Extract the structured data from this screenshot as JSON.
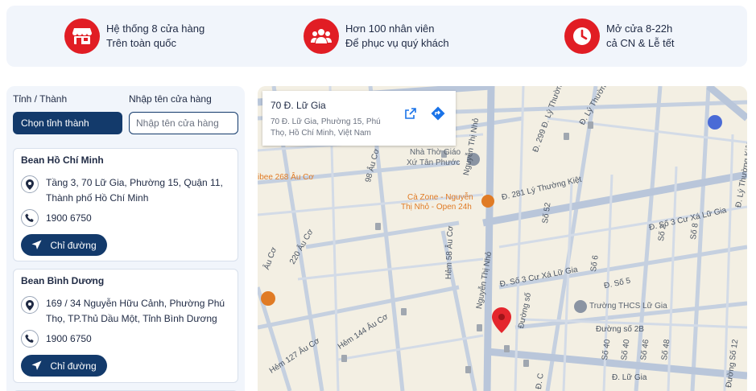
{
  "features": [
    {
      "icon": "store-icon",
      "line1": "Hệ thống 8 cửa hàng",
      "line2": "Trên toàn quốc"
    },
    {
      "icon": "people-icon",
      "line1": "Hơn 100 nhân viên",
      "line2": "Để phục vụ quý khách"
    },
    {
      "icon": "clock-icon",
      "line1": "Mở cửa 8-22h",
      "line2": "cả CN & Lễ tết"
    }
  ],
  "filters": {
    "province_label": "Tỉnh / Thành",
    "province_button": "Chọn tỉnh thành",
    "store_label": "Nhập tên cửa hàng",
    "store_placeholder": "Nhập tên cửa hàng"
  },
  "stores": [
    {
      "name": "Bean Hồ Chí Minh",
      "address": "Tầng 3, 70 Lữ Gia, Phường 15, Quận 11, Thành phố Hồ Chí Minh",
      "phone": "1900 6750",
      "directions": "Chỉ đường"
    },
    {
      "name": "Bean Bình Dương",
      "address": "169 / 34 Nguyễn Hữu Cảnh, Phường Phú Thọ, TP.Thủ Dầu Một, Tỉnh Bình Dương",
      "phone": "1900 6750",
      "directions": "Chỉ đường"
    }
  ],
  "map": {
    "info_title": "70 Đ. Lữ Gia",
    "info_address": "70 Đ. Lữ Gia, Phường 15, Phú Thọ, Hồ Chí Minh, Việt Nam",
    "labels": {
      "church1": "Nhà Thờ Giáo",
      "church2": "Xứ Tân Phước",
      "cazone1": "Cà Zone - Nguyễn",
      "cazone2": "Thị Nhỏ - Open 24h",
      "school": "Trường THCS Lữ Gia",
      "bee": "ibee 268 Âu Cơ",
      "ly_thuong_kiet": "Đ. 281 Lý Thường Kiệt",
      "nguyen_thi_nho": "Nguyễn Thị Nhỏ",
      "nguyen_thi_nho2": "Nguyễn Thị Nhỏ",
      "so3_cu_xa": "Đ. Số 3 Cư Xá Lữ Gia",
      "so3_cu_xa2": "Đ. Số 3 Cư Xá Lữ Gia",
      "so5": "Đ. Số 5",
      "so2b": "Đường số 2B",
      "lu_gia": "Đ. Lữ Gia",
      "hem58": "Hẻm 58 Âu Cơ",
      "hem144": "Hẻm 144 Âu Cơ",
      "hem127": "Hẻm 127 Âu Cơ",
      "au_co": "Âu Cơ",
      "hem220": "220 Âu Cơ",
      "hem98": "98 Âu Cơ",
      "ly_thuong_kiet2": "Đ. Lý Thường Kiệt",
      "ly_thuong_kiet3": "Đ. Lý Thường",
      "d299": "Đ. 299 Đ. Lý Thường Kiệt",
      "so52": "Số 52",
      "so6": "Số 6",
      "so2": "Số 2",
      "so40": "Số 40",
      "so8": "Số 8",
      "so46": "Số 46",
      "so48": "Số 48",
      "so40b": "Số 40",
      "d_c": "Đ. C",
      "duong_so12": "Đường Số 12",
      "duong_so": "Đường số"
    }
  }
}
